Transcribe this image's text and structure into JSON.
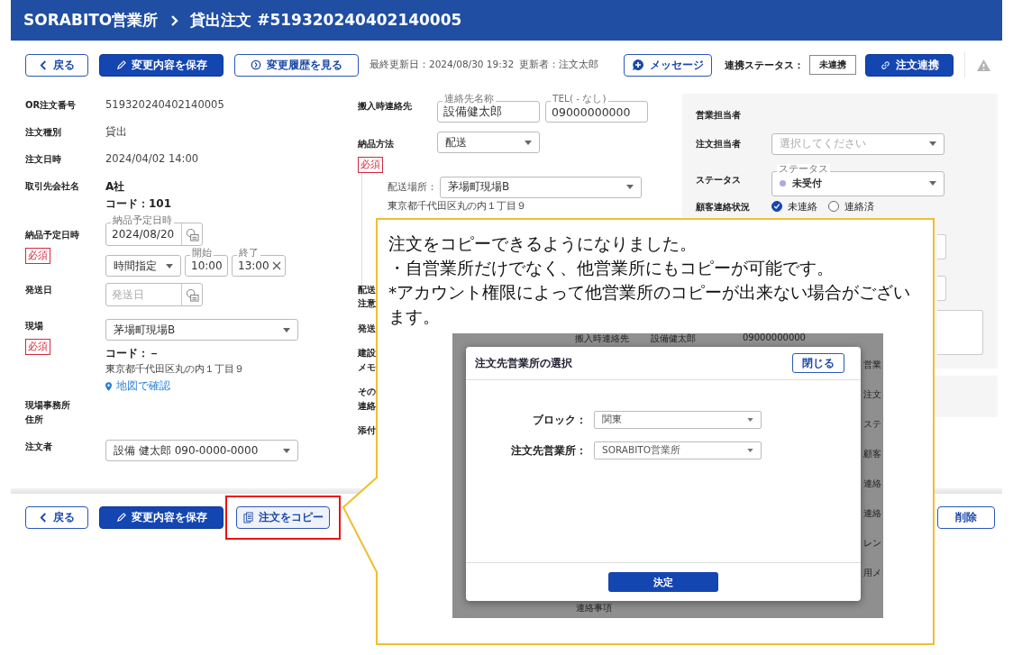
{
  "header": {
    "office": "SORABITO営業所",
    "title": "貸出注文 #519320240402140005"
  },
  "toolbar": {
    "back": "戻る",
    "save": "変更内容を保存",
    "history": "変更履歴を見る",
    "updated": "最終更新日：2024/08/30 19:32",
    "updater": "更新者：注文太郎",
    "message": "メッセージ",
    "link_status_label": "連携ステータス：",
    "link_status": "未連携",
    "link_button": "注文連携"
  },
  "left_fields": [
    {
      "kind": "text",
      "label": "OR注文番号",
      "value": "519320240402140005"
    },
    {
      "kind": "text",
      "label": "注文種別",
      "value": "貸出"
    },
    {
      "kind": "text",
      "label": "注文日時",
      "value": "2024/04/02 14:00"
    },
    {
      "kind": "company",
      "label": "取引先会社名",
      "name": "A社",
      "code": "コード：101"
    },
    {
      "kind": "schedule",
      "label": "納品予定日時",
      "required_label": "必須",
      "date_label": "納品予定日時",
      "date": "2024/08/20",
      "time_mode": "時間指定",
      "start_label": "開始",
      "start": "10:00",
      "end_label": "終了",
      "end": "13:00"
    },
    {
      "kind": "date",
      "label": "発送日",
      "placeholder": "発送日"
    },
    {
      "kind": "site",
      "label": "現場",
      "required_label": "必須",
      "value": "茅場町現場B",
      "code": "コード：－",
      "address": "東京都千代田区丸の内１丁目９",
      "map_link": "地図で確認"
    },
    {
      "kind": "label_only",
      "label_lines": [
        "現場事務所",
        "住所"
      ]
    },
    {
      "kind": "select",
      "label": "注文者",
      "value": "設備 健太郎 090-0000-0000"
    }
  ],
  "contact": {
    "label": "搬入時連絡先",
    "name_label": "連絡先名称",
    "name": "設備健太郎",
    "tel_label": "TEL( - なし)",
    "tel": "09000000000"
  },
  "delivery": {
    "label": "納品方法",
    "required_label": "必須",
    "value": "配送",
    "place_label": "配送場所：",
    "place": "茅場町現場B",
    "address": "東京都千代田区丸の内１丁目９"
  },
  "cut_labels": [
    [
      "配送",
      "注意"
    ],
    [
      "発送"
    ],
    [
      "建設",
      "メモ"
    ],
    [
      "その",
      "連絡"
    ],
    [
      "添付"
    ]
  ],
  "side_panel": {
    "sales_label": "営業担当者",
    "assignee_label": "注文担当者",
    "assignee_placeholder": "選択してください",
    "status_label": "ステータス",
    "status_float_label": "ステータス",
    "status": {
      "label": "未受付",
      "color": "#b3a6e3"
    },
    "contact_label": "顧客連絡状況",
    "contact_options": [
      {
        "label": "未連絡",
        "selected": true
      },
      {
        "label": "連絡済",
        "selected": false
      }
    ]
  },
  "footer": {
    "back": "戻る",
    "save": "変更内容を保存",
    "copy": "注文をコピー",
    "copy_highlighted": true,
    "delete": "削除"
  },
  "callout": {
    "lines": [
      "注文をコピーできるようになりました。",
      "・自営業所だけでなく、他営業所にもコピーが可能です。",
      "*アカウント権限によって他営業所のコピーが出来ない場合がございます。"
    ],
    "screenshot": {
      "top_texts": [
        "搬入時連絡先",
        "設備健太郎",
        "09000000000"
      ],
      "side_texts": [
        "営業",
        "注文",
        "ステ",
        "顧客",
        "連絡",
        "連絡",
        "レン",
        "用メ"
      ],
      "bottom_text": "連絡事項",
      "modal": {
        "title": "注文先営業所の選択",
        "close": "閉じる",
        "fields": [
          {
            "label": "ブロック：",
            "value": "関東"
          },
          {
            "label": "注文先営業所：",
            "value": "SORABITO営業所"
          }
        ],
        "submit": "決定"
      }
    }
  }
}
